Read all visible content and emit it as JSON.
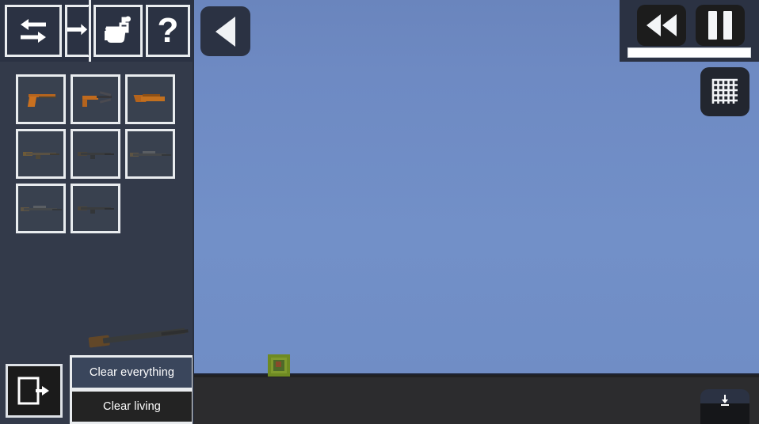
{
  "app": {
    "title": "Sandbox Weapon Editor",
    "sky_color": "#6f8cc4",
    "ground_color": "#2c2c2e",
    "panel_color": "#333a4a",
    "accent_color": "#e9ecef"
  },
  "left_panel": {
    "toolbar": [
      {
        "id": "swap",
        "icon": "swap-arrows-icon",
        "label": "Swap"
      },
      {
        "id": "collapse",
        "icon": "arrow-right-icon",
        "label": "Collapse"
      },
      {
        "id": "paint",
        "icon": "paint-bucket-icon",
        "label": "Paint"
      },
      {
        "id": "help",
        "icon": "question-mark-icon",
        "label": "Help"
      }
    ],
    "slots": [
      {
        "index": 1,
        "name": "Pistol",
        "style": "pistol"
      },
      {
        "index": 2,
        "name": "Submachine Gun",
        "style": "smg"
      },
      {
        "index": 3,
        "name": "Sawed-off Shotgun",
        "style": "shotgun"
      },
      {
        "index": 4,
        "name": "Carbine",
        "style": "rifle"
      },
      {
        "index": 5,
        "name": "Assault Rifle",
        "style": "rifle-dark"
      },
      {
        "index": 6,
        "name": "Battle Rifle",
        "style": "sniper"
      },
      {
        "index": 7,
        "name": "Marksman Rifle",
        "style": "sniper"
      },
      {
        "index": 8,
        "name": "Sniper Rifle",
        "style": "rifle-dark"
      }
    ],
    "exit_button": {
      "icon": "exit-door-icon",
      "label": "Exit"
    },
    "clear_menu": {
      "items": [
        {
          "label": "Clear everything",
          "state": "hover"
        },
        {
          "label": "Clear living",
          "state": "normal"
        }
      ]
    }
  },
  "world": {
    "back_button": {
      "icon": "play-left-triangle-icon",
      "label": "Back"
    },
    "entity": {
      "name": "spawned-block-entity",
      "color": "#7f9a2d"
    }
  },
  "hud": {
    "rewind_button": {
      "icon": "rewind-icon",
      "label": "Rewind"
    },
    "pause_button": {
      "icon": "pause-icon",
      "label": "Pause"
    },
    "timeline": {
      "name": "timeline-bar",
      "progress": 100
    },
    "grid_button": {
      "icon": "grid-icon",
      "label": "Toggle grid"
    },
    "download_button": {
      "icon": "download-icon",
      "label": "Save"
    }
  }
}
